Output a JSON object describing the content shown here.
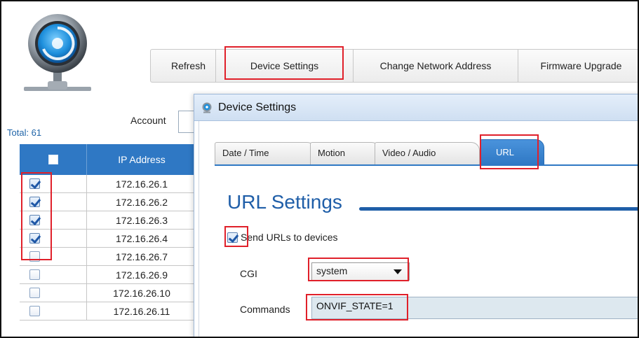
{
  "toolbar": {
    "refresh_label": "Refresh",
    "device_settings_label": "Device Settings",
    "change_network_label": "Change Network Address",
    "firmware_label": "Firmware Upgrade"
  },
  "account": {
    "label": "Account",
    "value": ""
  },
  "total": "Total: 61",
  "table": {
    "columns": [
      "",
      "IP Address"
    ],
    "rows": [
      {
        "checked": true,
        "ip": "172.16.26.1"
      },
      {
        "checked": true,
        "ip": "172.16.26.2"
      },
      {
        "checked": true,
        "ip": "172.16.26.3"
      },
      {
        "checked": true,
        "ip": "172.16.26.4"
      },
      {
        "checked": false,
        "ip": "172.16.26.7"
      },
      {
        "checked": false,
        "ip": "172.16.26.9"
      },
      {
        "checked": false,
        "ip": "172.16.26.10"
      },
      {
        "checked": false,
        "ip": "172.16.26.11"
      }
    ]
  },
  "dialog": {
    "title": "Device Settings",
    "tabs": [
      {
        "label": "Date / Time",
        "active": false
      },
      {
        "label": "Motion",
        "active": false
      },
      {
        "label": "Video / Audio",
        "active": false
      },
      {
        "label": "URL",
        "active": true
      }
    ],
    "section_title": "URL Settings",
    "send_urls": {
      "label": "Send URLs to devices",
      "checked": true
    },
    "cgi": {
      "label": "CGI",
      "value": "system"
    },
    "commands": {
      "label": "Commands",
      "value": "ONVIF_STATE=1"
    }
  },
  "colors": {
    "accent": "#2f78c4",
    "title": "#1f5ea8",
    "highlight": "#e0202a"
  },
  "icons": [
    "app-logo-icon",
    "dialog-app-icon",
    "dropdown-arrow-icon",
    "checkbox-icon"
  ]
}
